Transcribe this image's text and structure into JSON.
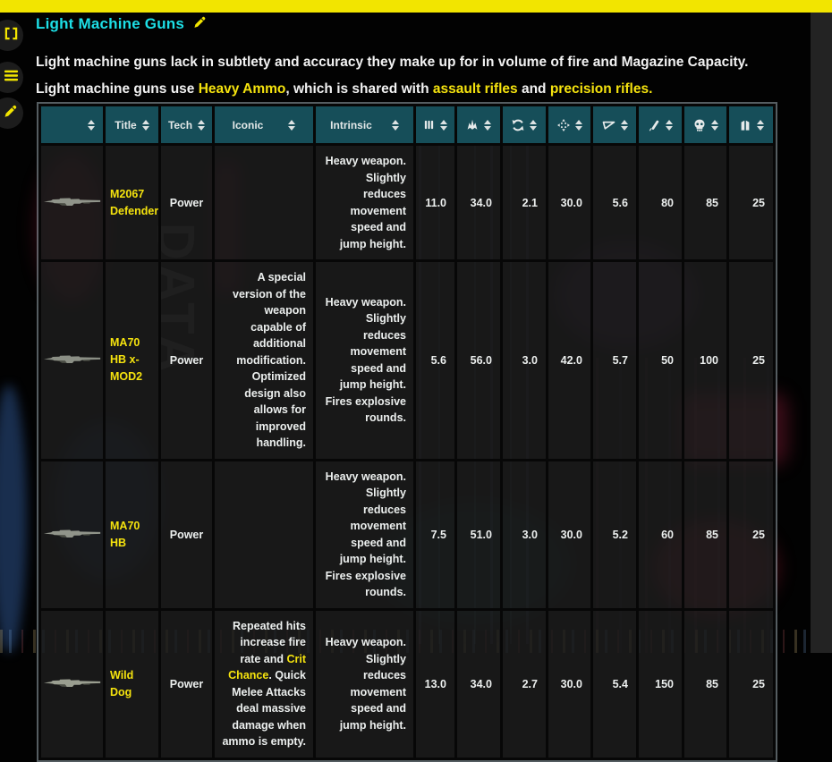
{
  "colors": {
    "accent_yellow": "#f2e500",
    "accent_cyan": "#1ddfe6",
    "link_yellow": "#f5e30e",
    "header_teal": "#164e59"
  },
  "background": {
    "watermark": "DATA"
  },
  "sidebar": {
    "buttons": [
      {
        "name": "focus-frame"
      },
      {
        "name": "menu"
      },
      {
        "name": "edit"
      }
    ]
  },
  "header": {
    "title": "Light Machine Guns"
  },
  "intro": {
    "line1": "Light machine guns lack in subtlety and accuracy they make up for in volume of fire and Magazine Capacity.",
    "line2": {
      "pre": "Light machine guns use ",
      "link1": "Heavy Ammo",
      "mid": ", which is shared with ",
      "link2": "assault rifles",
      "and": " and ",
      "link3": "precision rifles",
      "end": "."
    }
  },
  "table": {
    "columns": {
      "image": "",
      "title": "Title",
      "tech": "Tech",
      "iconic": "Iconic",
      "intrinsic": "Intrinsic"
    },
    "stat_icons": [
      "attacks-per-second",
      "damage",
      "reload-speed",
      "effective-range",
      "handling",
      "penetration",
      "headshot-multiplier",
      "magazine-capacity"
    ],
    "rows": [
      {
        "title": "M2067 Defender",
        "tech": "Power",
        "iconic": "",
        "intrinsic": "Heavy weapon. Slightly reduces movement speed and jump height.",
        "stats": [
          "11.0",
          "34.0",
          "2.1",
          "30.0",
          "5.6",
          "80",
          "85",
          "25"
        ]
      },
      {
        "title": "MA70 HB x-MOD2",
        "tech": "Power",
        "iconic": "A special version of the weapon capable of additional modification. Optimized design also allows for improved handling.",
        "intrinsic": "Heavy weapon. Slightly reduces movement speed and jump height. Fires explosive rounds.",
        "stats": [
          "5.6",
          "56.0",
          "3.0",
          "42.0",
          "5.7",
          "50",
          "100",
          "25"
        ]
      },
      {
        "title": "MA70 HB",
        "tech": "Power",
        "iconic": "",
        "intrinsic": "Heavy weapon. Slightly reduces movement speed and jump height. Fires explosive rounds.",
        "stats": [
          "7.5",
          "51.0",
          "3.0",
          "30.0",
          "5.2",
          "60",
          "85",
          "25"
        ]
      },
      {
        "title": "Wild Dog",
        "tech": "Power",
        "iconic_parts": {
          "pre": "Repeated hits increase fire rate and ",
          "link": "Crit Chance",
          "post": ". Quick Melee Attacks deal massive damage when ammo is empty."
        },
        "intrinsic": "Heavy weapon. Slightly reduces movement speed and jump height.",
        "stats": [
          "13.0",
          "34.0",
          "2.7",
          "30.0",
          "5.4",
          "150",
          "85",
          "25"
        ]
      }
    ]
  }
}
